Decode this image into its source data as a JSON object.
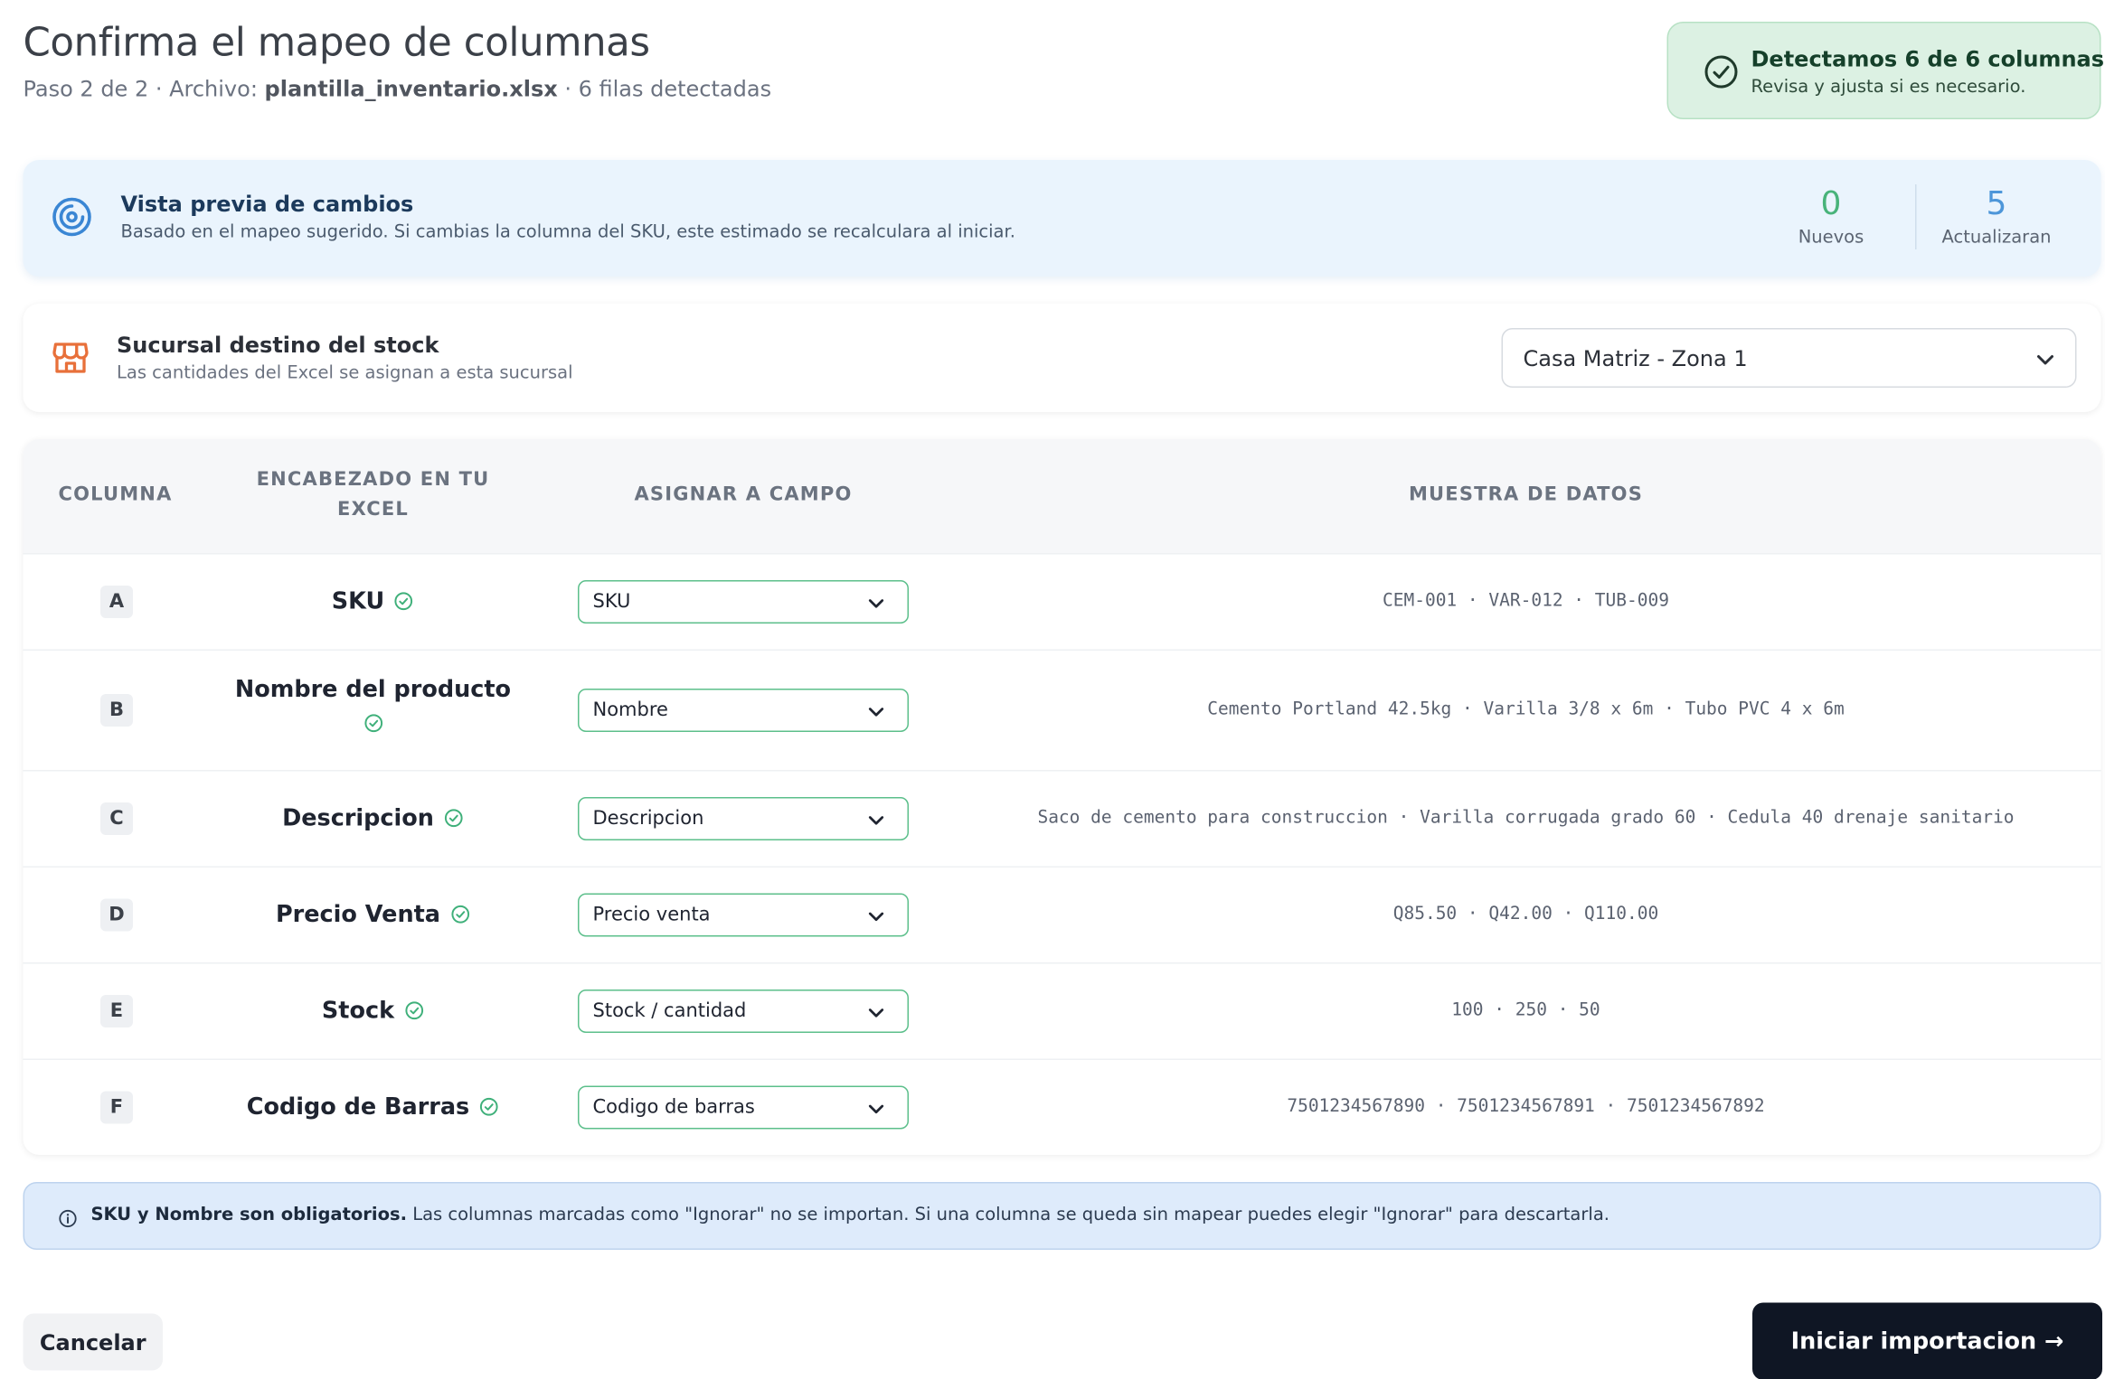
{
  "header": {
    "title": "Confirma el mapeo de columnas",
    "subtitle_prefix": "Paso 2 de 2 · Archivo:",
    "file_name": "plantilla_inventario.xlsx",
    "subtitle_suffix": "· 6 filas detectadas"
  },
  "detection": {
    "title": "Detectamos 6 de 6 columnas",
    "subtitle": "Revisa y ajusta si es necesario.",
    "icon": "check-circle-icon"
  },
  "preview": {
    "title": "Vista previa de cambios",
    "subtitle": "Basado en el mapeo sugerido. Si cambias la columna del SKU, este estimado se recalculara al iniciar.",
    "icon": "gauge-icon",
    "new_count": "0",
    "new_label": "Nuevos",
    "update_count": "5",
    "update_label": "Actualizaran"
  },
  "branch": {
    "title": "Sucursal destino del stock",
    "subtitle": "Las cantidades del Excel se asignan a esta sucursal",
    "icon": "store-icon",
    "selected": "Casa Matriz - Zona 1"
  },
  "table": {
    "headers": {
      "column": "COLUMNA",
      "excel_header": "ENCABEZADO EN TU EXCEL",
      "assign_field": "ASIGNAR A CAMPO",
      "data_sample": "MUESTRA DE DATOS"
    },
    "rows": [
      {
        "letter": "A",
        "header": "SKU",
        "field": "SKU",
        "sample": "CEM-001 · VAR-012 · TUB-009"
      },
      {
        "letter": "B",
        "header": "Nombre del producto",
        "field": "Nombre",
        "sample": "Cemento Portland 42.5kg · Varilla 3/8 x 6m · Tubo PVC 4 x 6m"
      },
      {
        "letter": "C",
        "header": "Descripcion",
        "field": "Descripcion",
        "sample": "Saco de cemento para construccion · Varilla corrugada grado 60 · Cedula 40 drenaje sanitario"
      },
      {
        "letter": "D",
        "header": "Precio Venta",
        "field": "Precio venta",
        "sample": "Q85.50 · Q42.00 · Q110.00"
      },
      {
        "letter": "E",
        "header": "Stock",
        "field": "Stock / cantidad",
        "sample": "100 · 250 · 50"
      },
      {
        "letter": "F",
        "header": "Codigo de Barras",
        "field": "Codigo de barras",
        "sample": "7501234567890 · 7501234567891 · 7501234567892"
      }
    ]
  },
  "info": {
    "bold": "SKU y Nombre son obligatorios.",
    "text": " Las columnas marcadas como \"Ignorar\" no se importan. Si una columna se queda sin mapear puedes elegir \"Ignorar\" para descartarla."
  },
  "footer": {
    "cancel_label": "Cancelar",
    "start_label": "Iniciar importacion →"
  },
  "colors": {
    "success": "#3fb07a",
    "primary_blue": "#4d96d9",
    "store_orange": "#e8703a",
    "dark_button": "#0f1624"
  }
}
